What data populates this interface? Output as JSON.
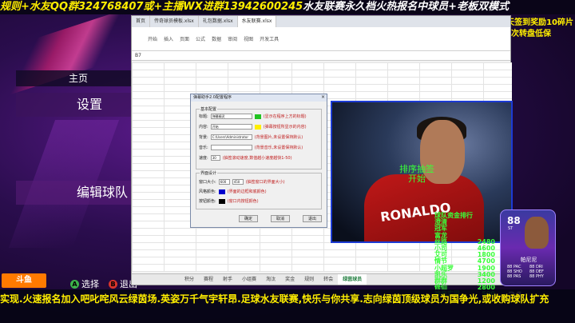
{
  "top_banner": {
    "seg1": "规则+水友QQ群324768407或+主播WX进群13942600245",
    "seg2": "水友联赛永久档火热报名中球员+老板双模式"
  },
  "promo": {
    "line1": "老板每天签到奖励10碎片",
    "line2": "2张为卡 1次转盘低保"
  },
  "game_menu": {
    "home": "主页",
    "settings": "设置",
    "edit_team": "编辑球队"
  },
  "controls": {
    "select_key": "A",
    "select_label": "选择",
    "exit_key": "B",
    "exit_label": "退出"
  },
  "logo_text": "斗鱼",
  "bottom_banner": {
    "line1": "实现.火速报名加入吧叱咤风云绿茵场.英姿万千气宇轩昂.足球水友联赛,快乐与你共享.志向绿茵顶级球员为国争光,或收购球队扩充",
    "line2": ""
  },
  "excel": {
    "tabs": [
      "首页",
      "传奇球员模板.xlsx",
      "礼包数据.xlsx",
      "水友联赛.xlsx"
    ],
    "active_tab": 3,
    "ribbon": [
      "开始",
      "插入",
      "页面",
      "公式",
      "数据",
      "审阅",
      "视图",
      "开发工具"
    ],
    "cell_ref": "B7",
    "sheet_tabs": [
      "积分",
      "赛程",
      "射手",
      "小组赛",
      "淘汰",
      "奖金",
      "规则",
      "转会",
      "绿茵球员"
    ],
    "active_sheet": 8
  },
  "dialog": {
    "title": "弹幕助手2.0配置程序",
    "close": "×",
    "group1": "基本配置",
    "group2": "界面设计",
    "rows": [
      {
        "label": "标题:",
        "value": "弹幕精灵",
        "hint": "(显示在程序上方的标题)"
      },
      {
        "label": "内容:",
        "value": "开始",
        "hint": "(弹幕按钮所显示的内容)"
      },
      {
        "label": "背景:",
        "value": "C:\\Users\\Administrator",
        "hint": "(背景图片,未设置保持默认)"
      },
      {
        "label": "音乐:",
        "value": "",
        "hint": "(背景音乐,未设置保持默认)"
      },
      {
        "label": "速度:",
        "value": "30",
        "hint": "(抽签滚动速度,数值越小速度越快1-50)"
      }
    ],
    "size_label": "窗口大小:",
    "size_w": "600",
    "size_h": "450",
    "size_hint": "(抽签窗口的界面大小)",
    "border_label": "风格颜色:",
    "border_hint": "(界面的边框和底颜色)",
    "bg_label": "按钮颜色:",
    "bg_hint": "(窗口内按钮颜色)",
    "buttons": [
      "确定",
      "取消",
      "退出"
    ],
    "colors": {
      "green": "#22c322",
      "yellow": "#ffee00",
      "blue": "#0000cc",
      "black": "#000000"
    }
  },
  "video": {
    "caption_line1": "排序抽签",
    "caption_line2": "开始",
    "jersey_text": "RONALDO"
  },
  "ranking": {
    "title": "球队资金排行",
    "rows": [
      {
        "name": "澄清",
        "value": ""
      },
      {
        "name": "冠军",
        "value": ""
      },
      {
        "name": "富龙",
        "value": ""
      },
      {
        "name": "丝路",
        "value": "2480"
      },
      {
        "name": "小司",
        "value": "4600"
      },
      {
        "name": "艾可",
        "value": "1800"
      },
      {
        "name": "情节",
        "value": "4700"
      },
      {
        "name": "小超罗",
        "value": "1900"
      },
      {
        "name": "凯乐",
        "value": "3400"
      },
      {
        "name": "群群",
        "value": "1200"
      },
      {
        "name": "修仙",
        "value": "2800"
      },
      {
        "name": "神鹿实现",
        "value": "500"
      }
    ]
  },
  "player_card": {
    "rating": "88",
    "position": "ST",
    "name": "帕尼尼",
    "stats": [
      "88 PAC",
      "88 DRI",
      "88 SHO",
      "88 DEF",
      "88 PAS",
      "88 PHY"
    ],
    "number": "21"
  }
}
